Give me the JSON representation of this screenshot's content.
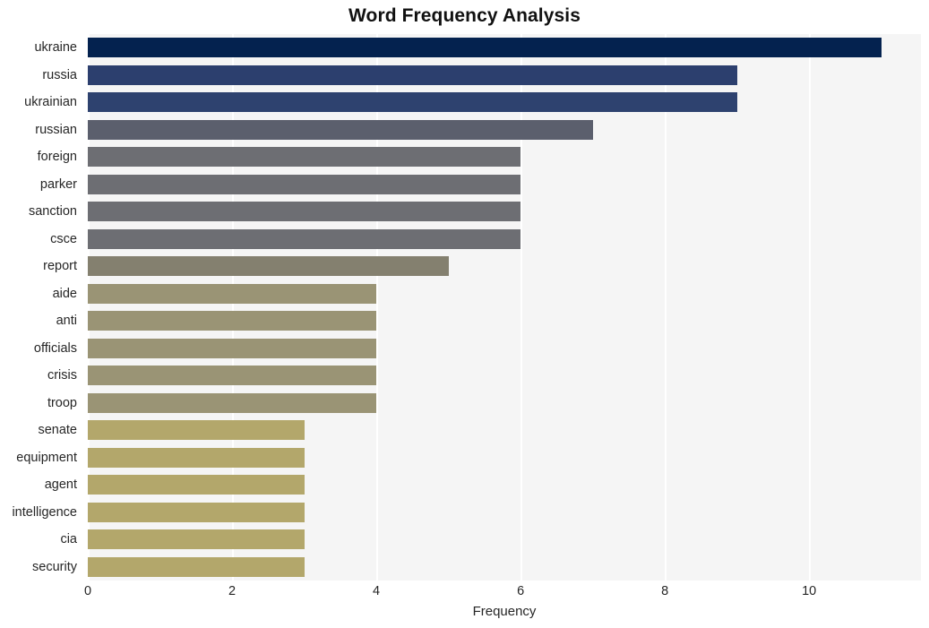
{
  "chart_data": {
    "type": "bar",
    "orientation": "horizontal",
    "title": "Word Frequency Analysis",
    "xlabel": "Frequency",
    "ylabel": "",
    "categories": [
      "ukraine",
      "russia",
      "ukrainian",
      "russian",
      "foreign",
      "parker",
      "sanction",
      "csce",
      "report",
      "aide",
      "anti",
      "officials",
      "crisis",
      "troop",
      "senate",
      "equipment",
      "agent",
      "intelligence",
      "cia",
      "security"
    ],
    "values": [
      11,
      9,
      9,
      7,
      6,
      6,
      6,
      6,
      5,
      4,
      4,
      4,
      4,
      4,
      3,
      3,
      3,
      3,
      3,
      3
    ],
    "bar_colors": [
      "#04224f",
      "#2c3f6e",
      "#2e426f",
      "#5b5f6d",
      "#6d6e73",
      "#6d6e73",
      "#6d6e73",
      "#6d6e73",
      "#84806f",
      "#9a9475",
      "#9a9475",
      "#9a9475",
      "#9a9475",
      "#9a9475",
      "#b3a76b",
      "#b3a76b",
      "#b3a76b",
      "#b3a76b",
      "#b3a76b",
      "#b3a76b"
    ],
    "xticks": [
      0,
      2,
      4,
      6,
      8,
      10
    ],
    "xtick_labels": [
      "0",
      "2",
      "4",
      "6",
      "8",
      "10"
    ],
    "xlim": [
      0,
      11.55
    ],
    "gridlines": {
      "axis": "x",
      "visible": true,
      "color": "#ffffff"
    },
    "legend": null,
    "plot_background": "#f5f5f5",
    "figure_background": "#ffffff"
  }
}
